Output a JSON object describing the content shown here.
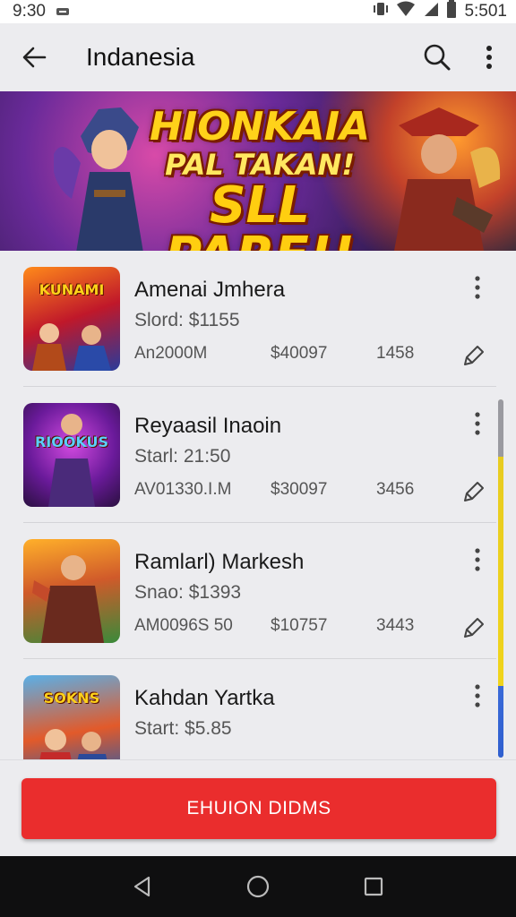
{
  "status_bar": {
    "time_left": "9:30",
    "time_right": "5:501"
  },
  "app_bar": {
    "title": "Indanesia"
  },
  "banner": {
    "line1": "HIONKAIA",
    "line2": "PAL TAKAN!",
    "line3": "SLL PARE!!"
  },
  "items": [
    {
      "name": "Amenai Jmhera",
      "start": "Slord: $1155",
      "col_a": "An2000M",
      "col_b": "$40097",
      "col_c": "1458",
      "thumb_text": "KUNAMI",
      "thumb_colors": [
        "#ff7a1a",
        "#c0182a",
        "#2a3a9a"
      ]
    },
    {
      "name": "Reyaasil Inaoin",
      "start": "Starl: 21:50",
      "col_a": "AV01330.I.M",
      "col_b": "$30097",
      "col_c": "3456",
      "thumb_text": "RIOOKUS",
      "thumb_colors": [
        "#c23ad6",
        "#5a1a8a",
        "#2a1a4a"
      ]
    },
    {
      "name": "Ramlarl) Markesh",
      "start": "Snao: $1393",
      "col_a": "AM0096S 50",
      "col_b": "$10757",
      "col_c": "3443",
      "thumb_text": "",
      "thumb_colors": [
        "#ffa020",
        "#c4462a",
        "#3a8a3a"
      ]
    },
    {
      "name": "Kahdan Yartka",
      "start": "Start: $5.85",
      "col_a": "",
      "col_b": "",
      "col_c": "",
      "thumb_text": "SOKNS",
      "thumb_colors": [
        "#3a9ad8",
        "#e24a2a",
        "#2a5aa8"
      ]
    }
  ],
  "cta": {
    "label": "EHUION DIDMS"
  },
  "icons": {
    "back": "arrow-left-icon",
    "search": "search-icon",
    "more": "more-vertical-icon",
    "row_action": "edit-tag-icon",
    "nav_back": "triangle-back-icon",
    "nav_home": "circle-home-icon",
    "nav_recents": "square-recents-icon"
  },
  "colors": {
    "cta": "#ea2d2d",
    "banner_text": "#ffd21a"
  }
}
